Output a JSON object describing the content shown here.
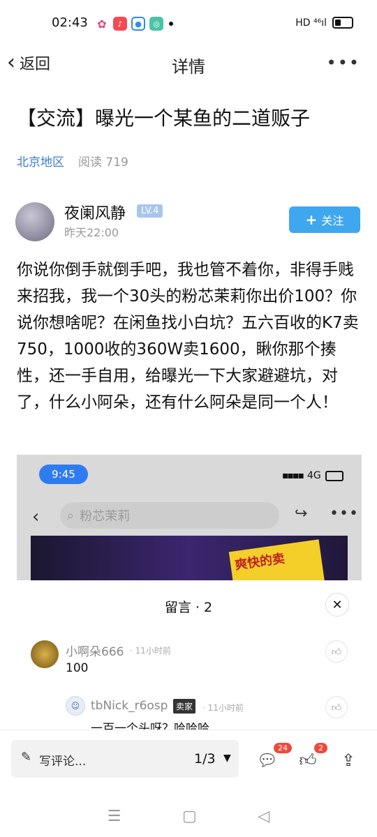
{
  "status": {
    "time": "02:43",
    "network": "HD ⁴⁶ıl"
  },
  "nav": {
    "back_label": "返回",
    "title": "详情",
    "more": "•••"
  },
  "post": {
    "title": "【交流】曝光一个某鱼的二道贩子",
    "region": "北京地区",
    "reads": "阅读 719",
    "author": "夜阑风静",
    "level": "LV.4",
    "time": "昨天22:00",
    "follow_label": "关注",
    "body": "你说你倒手就倒手吧，我也管不着你，非得手贱来招我，我一个30头的粉芯茉莉你出价100？你说你想啥呢？在闲鱼找小白坑？五六百收的K7卖750，1000收的360W卖1600，瞅你那个揍性，还一手自用，给曝光一下大家避避坑，对了，什么小阿朵，还有什么阿朵是同一个人！"
  },
  "embedded": {
    "time": "9:45",
    "signal": "4G",
    "search_text": "粉芯茉莉",
    "banner_text": "爽快的卖"
  },
  "comments": {
    "title": "留言 · 2",
    "items": [
      {
        "name": "小啊朵666",
        "time": "· 11小时前",
        "text": "100"
      },
      {
        "name": "tbNick_r6osp",
        "tag": "卖家",
        "time": "· 11小时前",
        "text": "一百一个头呀？哈哈哈"
      }
    ]
  },
  "bottom": {
    "placeholder": "写评论...",
    "pager": "1/3",
    "comment_count": "24",
    "like_count": "2"
  }
}
